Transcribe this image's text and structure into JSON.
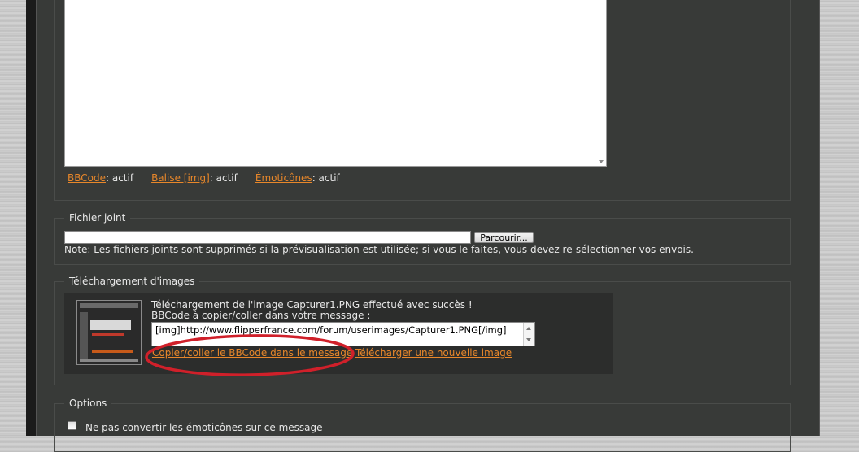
{
  "editor": {
    "status": {
      "bbcode_link": "BBCode",
      "bbcode_state": ": actif",
      "img_link": "Balise [img]",
      "img_state": ": actif",
      "emoticons_link": "Émoticônes",
      "emoticons_state": ": actif"
    }
  },
  "attachment": {
    "legend": "Fichier joint",
    "browse_label": "Parcourir...",
    "note": "Note: Les fichiers joints sont supprimés si la prévisualisation est utilisée; si vous le faites, vous devez re-sélectionner vos envois."
  },
  "image_upload": {
    "legend": "Téléchargement d'images",
    "success_message": "Téléchargement de l'image Capturer1.PNG effectué avec succès !",
    "bbcode_prompt": "BBCode à copier/coller dans votre message :",
    "bbcode_value": "[img]http://www.flipperfrance.com/forum/userimages/Capturer1.PNG[/img]",
    "copy_link": "Copier/coller le BBCode dans le message",
    "new_image_link": "Télécharger une nouvelle image",
    "annotation_color": "#d0202a"
  },
  "options": {
    "legend": "Options",
    "no_emoticons_label": "Ne pas convertir les émoticônes sur ce message"
  }
}
